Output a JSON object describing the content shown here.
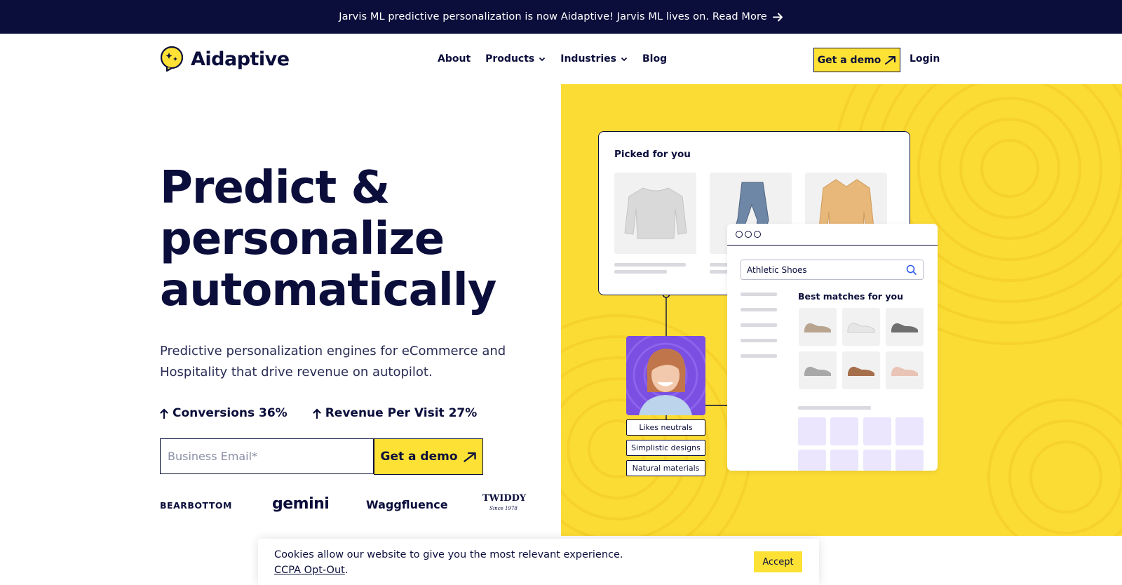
{
  "announcement": {
    "text": "Jarvis ML predictive personalization is now Aidaptive! Jarvis ML lives on. Read More"
  },
  "header": {
    "logo_text": "Aidaptive",
    "nav": [
      {
        "label": "About"
      },
      {
        "label": "Products"
      },
      {
        "label": "Industries"
      },
      {
        "label": "Blog"
      }
    ],
    "demo_label": "Get a demo",
    "login_label": "Login"
  },
  "hero": {
    "title_line1": "Predict &",
    "title_line2": "personalize",
    "title_line3": "automatically",
    "subtitle": "Predictive personalization engines for eCommerce and Hospitality that drive revenue on autopilot.",
    "stats": [
      {
        "label": "Conversions 36%"
      },
      {
        "label": "Revenue Per Visit 27%"
      }
    ],
    "email_placeholder": "Business Email*",
    "demo_label": "Get a demo",
    "client_logos": {
      "bearbottom": "BEARBOTTOM",
      "gemini": "gemini",
      "waggfluence": "Waggfluence",
      "twiddy": "TWIDDY",
      "twiddy_since": "Since 1978"
    }
  },
  "illustration": {
    "picked_title": "Picked for you",
    "search_value": "Athletic Shoes",
    "best_matches_title": "Best matches for you",
    "tags": [
      "Likes neutrals",
      "Simplistic designs",
      "Natural materials"
    ]
  },
  "cookie": {
    "message": "Cookies allow our website to give you the most relevant experience.",
    "link_label": "CCPA Opt-Out",
    "period": ".",
    "accept_label": "Accept"
  },
  "colors": {
    "navy": "#0b0e3b",
    "yellow": "#fde134",
    "art_background": "#fbdc35",
    "highlight": "#3fd3f2",
    "avatar_bg": "#7a4fe2",
    "lavender": "#ebe6fd"
  }
}
